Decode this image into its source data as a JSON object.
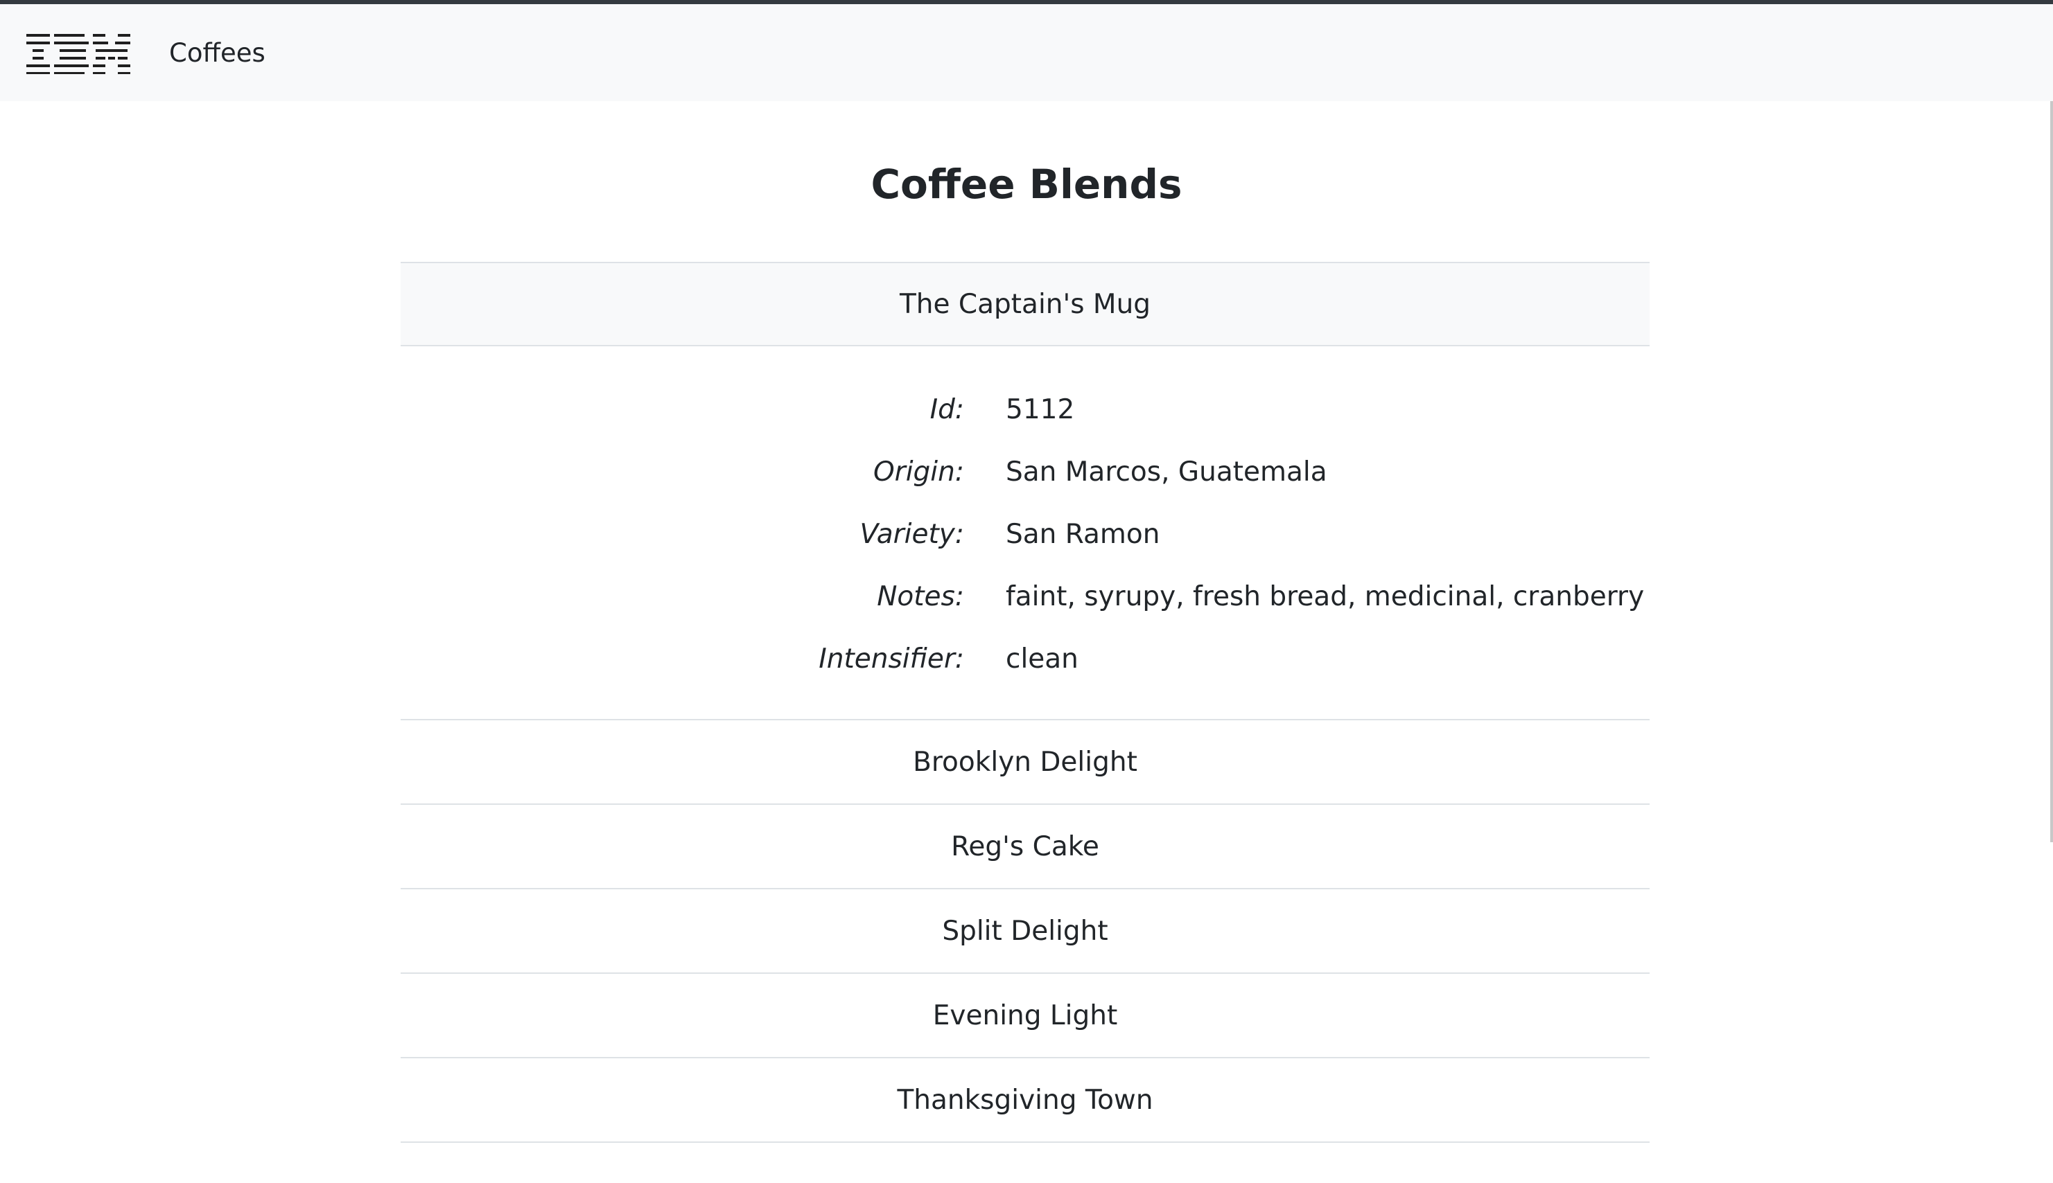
{
  "navbar": {
    "logo_text": "IBM",
    "brand_label": "Coffees"
  },
  "page": {
    "title": "Coffee Blends"
  },
  "blends": [
    {
      "name": "The Captain's Mug",
      "expanded": true,
      "details": [
        {
          "label": "Id:",
          "value": "5112"
        },
        {
          "label": "Origin:",
          "value": "San Marcos, Guatemala"
        },
        {
          "label": "Variety:",
          "value": "San Ramon"
        },
        {
          "label": "Notes:",
          "value": "faint, syrupy, fresh bread, medicinal, cranberry"
        },
        {
          "label": "Intensifier:",
          "value": "clean"
        }
      ]
    },
    {
      "name": "Brooklyn Delight"
    },
    {
      "name": "Reg's Cake"
    },
    {
      "name": "Split Delight"
    },
    {
      "name": "Evening Light"
    },
    {
      "name": "Thanksgiving Town"
    }
  ]
}
